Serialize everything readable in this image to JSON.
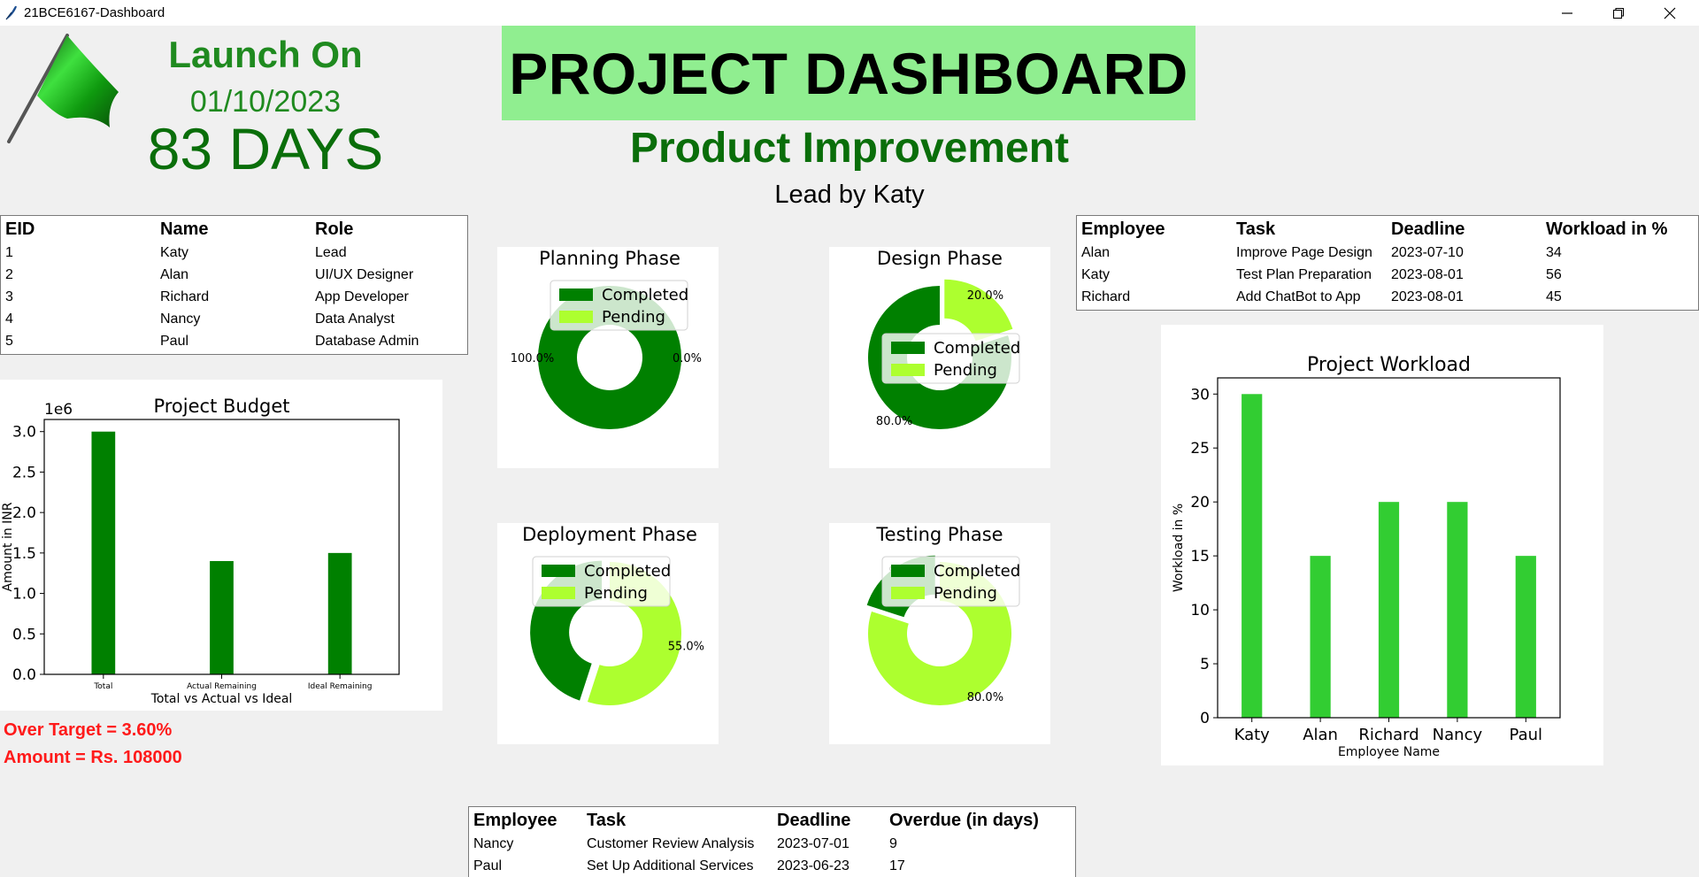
{
  "window": {
    "title": "21BCE6167-Dashboard"
  },
  "launch": {
    "label": "Launch On",
    "date": "01/10/2023",
    "days": "83 DAYS"
  },
  "header": {
    "title": "PROJECT DASHBOARD",
    "project": "Product Improvement",
    "lead": "Lead by Katy"
  },
  "colors": {
    "dark_green": "#008000",
    "light_green": "#adff2f",
    "bar_green": "#32cd32",
    "title_bg": "#90ee90",
    "alert_red": "#ff1a1a"
  },
  "team_table": {
    "headers": [
      "EID",
      "Name",
      "Role"
    ],
    "rows": [
      [
        "1",
        "Katy",
        "Lead"
      ],
      [
        "2",
        "Alan",
        "UI/UX Designer"
      ],
      [
        "3",
        "Richard",
        "App Developer"
      ],
      [
        "4",
        "Nancy",
        "Data Analyst"
      ],
      [
        "5",
        "Paul",
        "Database Admin"
      ]
    ]
  },
  "task_table": {
    "headers": [
      "Employee",
      "Task",
      "Deadline",
      "Workload in %"
    ],
    "rows": [
      [
        "Alan",
        "Improve Page Design",
        "2023-07-10",
        "34"
      ],
      [
        "Katy",
        "Test Plan Preparation",
        "2023-08-01",
        "56"
      ],
      [
        "Richard",
        "Add ChatBot to App",
        "2023-08-01",
        "45"
      ]
    ]
  },
  "overdue_table": {
    "headers": [
      "Employee",
      "Task",
      "Deadline",
      "Overdue (in days)"
    ],
    "rows": [
      [
        "Nancy",
        "Customer Review Analysis",
        "2023-07-01",
        "9"
      ],
      [
        "Paul",
        "Set Up Additional Services",
        "2023-06-23",
        "17"
      ]
    ]
  },
  "budget_alert": {
    "over_target": "Over Target = 3.60%",
    "amount": "Amount = Rs. 108000"
  },
  "chart_data": [
    {
      "id": "budget",
      "type": "bar",
      "title": "Project Budget",
      "xlabel": "Total vs Actual vs Ideal",
      "ylabel": "Amount in INR",
      "offset_label": "1e6",
      "categories": [
        "Total",
        "Actual Remaining",
        "Ideal Remaining"
      ],
      "values": [
        3000000,
        1400000,
        1500000
      ],
      "ylim": [
        0,
        3150000
      ],
      "yticks": [
        0.0,
        0.5,
        1.0,
        1.5,
        2.0,
        2.5,
        3.0
      ],
      "color": "#008000"
    },
    {
      "id": "planning",
      "type": "pie",
      "title": "Planning Phase",
      "labels": [
        "Completed",
        "Pending"
      ],
      "values": [
        100.0,
        0.0
      ],
      "pct_labels": [
        "100.0%",
        "0.0%"
      ],
      "colors": [
        "#008000",
        "#adff2f"
      ],
      "legend": "upper center"
    },
    {
      "id": "design",
      "type": "pie",
      "title": "Design Phase",
      "labels": [
        "Completed",
        "Pending"
      ],
      "values": [
        80.0,
        20.0
      ],
      "pct_labels": [
        "80.0%",
        "20.0%"
      ],
      "colors": [
        "#008000",
        "#adff2f"
      ],
      "legend": "center right"
    },
    {
      "id": "deployment",
      "type": "pie",
      "title": "Deployment Phase",
      "labels": [
        "Completed",
        "Pending"
      ],
      "values": [
        45.0,
        55.0
      ],
      "pct_labels": [
        "",
        "55.0%"
      ],
      "colors": [
        "#008000",
        "#adff2f"
      ],
      "legend": "upper center"
    },
    {
      "id": "testing",
      "type": "pie",
      "title": "Testing Phase",
      "labels": [
        "Completed",
        "Pending"
      ],
      "values": [
        20.0,
        80.0
      ],
      "pct_labels": [
        "%",
        "80.0%"
      ],
      "colors": [
        "#008000",
        "#adff2f"
      ],
      "legend": "upper center"
    },
    {
      "id": "workload",
      "type": "bar",
      "title": "Project Workload",
      "xlabel": "Employee Name",
      "ylabel": "Workload in %",
      "categories": [
        "Katy",
        "Alan",
        "Richard",
        "Nancy",
        "Paul"
      ],
      "values": [
        30,
        15,
        20,
        20,
        15
      ],
      "ylim": [
        0,
        31.5
      ],
      "yticks": [
        0,
        5,
        10,
        15,
        20,
        25,
        30
      ],
      "color": "#32cd32"
    }
  ]
}
